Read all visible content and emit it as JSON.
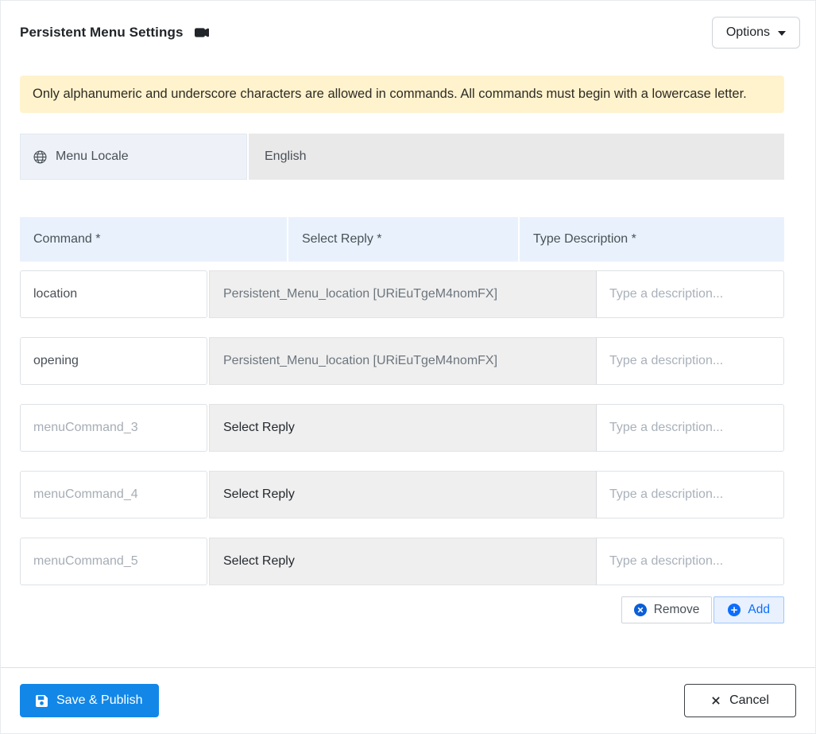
{
  "header": {
    "title": "Persistent Menu Settings",
    "options_button": "Options"
  },
  "banner": {
    "text": "Only alphanumeric and underscore characters are allowed in commands. All commands must begin with a lowercase letter."
  },
  "locale": {
    "label": "Menu Locale",
    "value": "English"
  },
  "table": {
    "headers": {
      "command": "Command *",
      "reply": "Select Reply *",
      "description": "Type Description *"
    },
    "rows": [
      {
        "command_value": "location",
        "reply_text": "Persistent_Menu_location [URiEuTgeM4nomFX]",
        "description_placeholder": "Type a description..."
      },
      {
        "command_value": "opening",
        "reply_text": "Persistent_Menu_location [URiEuTgeM4nomFX]",
        "description_placeholder": "Type a description..."
      },
      {
        "command_placeholder": "menuCommand_3",
        "reply_text": "Select Reply",
        "description_placeholder": "Type a description..."
      },
      {
        "command_placeholder": "menuCommand_4",
        "reply_text": "Select Reply",
        "description_placeholder": "Type a description..."
      },
      {
        "command_placeholder": "menuCommand_5",
        "reply_text": "Select Reply",
        "description_placeholder": "Type a description..."
      }
    ]
  },
  "row_actions": {
    "remove": "Remove",
    "add": "Add"
  },
  "footer": {
    "save": "Save & Publish",
    "cancel": "Cancel"
  },
  "colors": {
    "primary": "#1287e8",
    "accent": "#0d6efd",
    "add_bg": "#e8f1fd",
    "add_border": "#9ec5fe",
    "banner_bg": "#fff3cd",
    "header_cell_bg": "#e9f2fc",
    "locale_label_bg": "#eef2f8",
    "locale_value_bg": "#e9e9e9",
    "reply_bg": "#efefef"
  }
}
